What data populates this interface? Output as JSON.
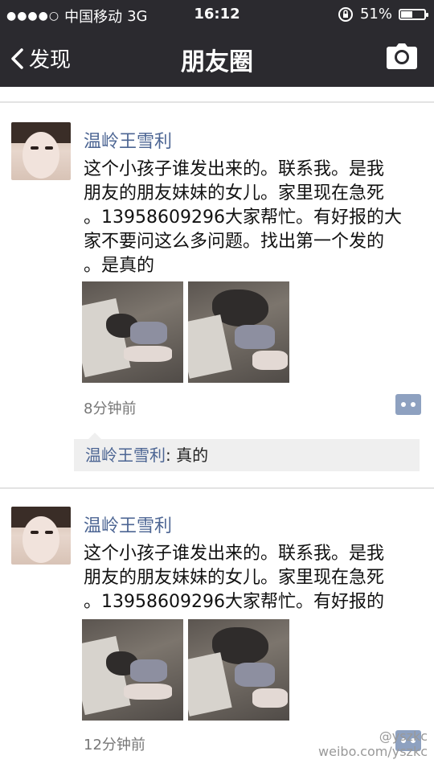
{
  "status_bar": {
    "carrier": "中国移动",
    "network": "3G",
    "time": "16:12",
    "battery_percent": "51%",
    "battery_level": 0.51
  },
  "nav": {
    "back_label": "发现",
    "title": "朋友圈"
  },
  "posts": [
    {
      "author": "温岭王雪利",
      "text_lines": [
        "这个小孩子谁发出来的。联系我。是我",
        "朋友的朋友妹妹的女儿。家里现在急死",
        "。13958609296大家帮忙。有好报的大",
        "家不要问这么多问题。找出第一个发的",
        "。是真的"
      ],
      "time_ago": "8分钟前",
      "comment": {
        "author": "温岭王雪利",
        "separator": ":",
        "text": "真的"
      }
    },
    {
      "author": "温岭王雪利",
      "text_lines": [
        "这个小孩子谁发出来的。联系我。是我",
        "朋友的朋友妹妹的女儿。家里现在急死",
        "。13958609296大家帮忙。有好报的"
      ],
      "time_ago": "12分钟前"
    }
  ],
  "watermark": {
    "handle": "@yszkc",
    "url": "weibo.com/yszkc"
  },
  "colors": {
    "bar_bg": "#2b2a2f",
    "name_blue": "#4c6593",
    "comment_bg": "#efefef"
  }
}
